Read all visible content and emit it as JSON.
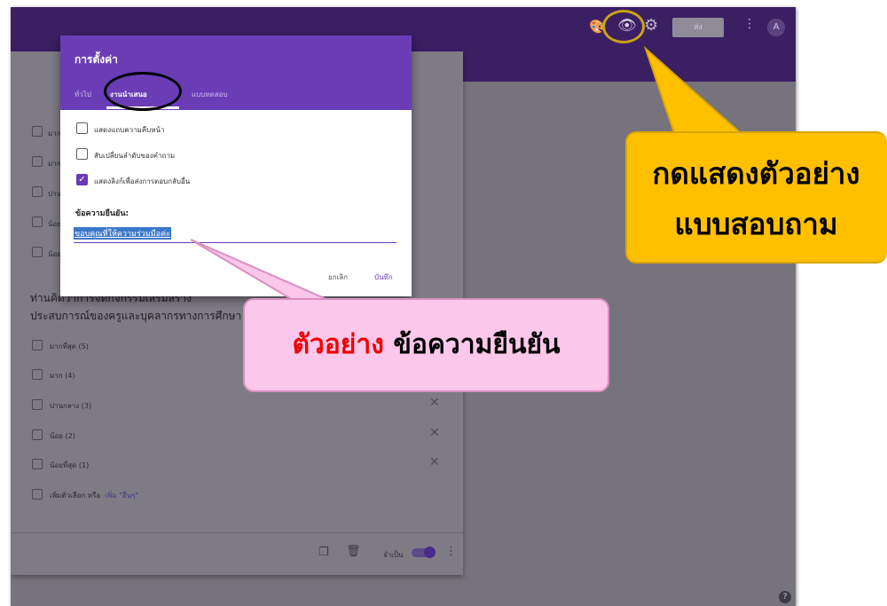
{
  "toolbar": {
    "send_label": "ส่ง",
    "avatar_letter": "A",
    "icons": [
      "palette-icon",
      "eye-icon",
      "gear-icon",
      "more-vert-icon"
    ]
  },
  "settings_dialog": {
    "title": "การตั้งค่า",
    "tabs": [
      "ทั่วไป",
      "งานนำเสนอ",
      "แบบทดสอบ"
    ],
    "options": [
      {
        "label": "แสดงแถบความคืบหน้า",
        "checked": false
      },
      {
        "label": "สับเปลี่ยนลำดับของคำถาม",
        "checked": false
      },
      {
        "label": "แสดงลิงก์เพื่อส่งการตอบกลับอื่น",
        "checked": true
      }
    ],
    "confirm_label": "ข้อความยืนยัน:",
    "confirm_value": "ขอบคุณที่ให้ความร่วมมือค่ะ",
    "cancel_label": "ยกเลิก",
    "save_label": "บันทึก"
  },
  "form": {
    "question": "ท่านคิดว่าการจัดกิจกรรมเสริมสร้าง\nประสบการณ์ของครูและบุคลากรทางการศึกษา",
    "options": [
      "มากที่สุด (5)",
      "มาก (4)",
      "ปานกลาง (3)",
      "น้อย (2)",
      "น้อยที่สุด (1)"
    ],
    "add_option": "เพิ่มตัวเลือก  หรือ",
    "add_other": "เพิ่ม \"อื่นๆ\"",
    "required_label": "จำเป็น",
    "hidden_option_snippets": [
      "มาก",
      "มาก",
      "ปาน",
      "น้อย",
      "น้อย"
    ]
  },
  "annotations": {
    "yellow_callout": "กดแสดงตัวอย่าง\nแบบสอบถาม",
    "pink_callout_red": "ตัวอย่าง",
    "pink_callout_black": "ข้อความยืนยัน"
  },
  "colors": {
    "header_purple": "#3b1f63",
    "dialog_purple": "#6a3db7",
    "callout_yellow": "#ffc000",
    "callout_pink": "#fbc7ea"
  }
}
